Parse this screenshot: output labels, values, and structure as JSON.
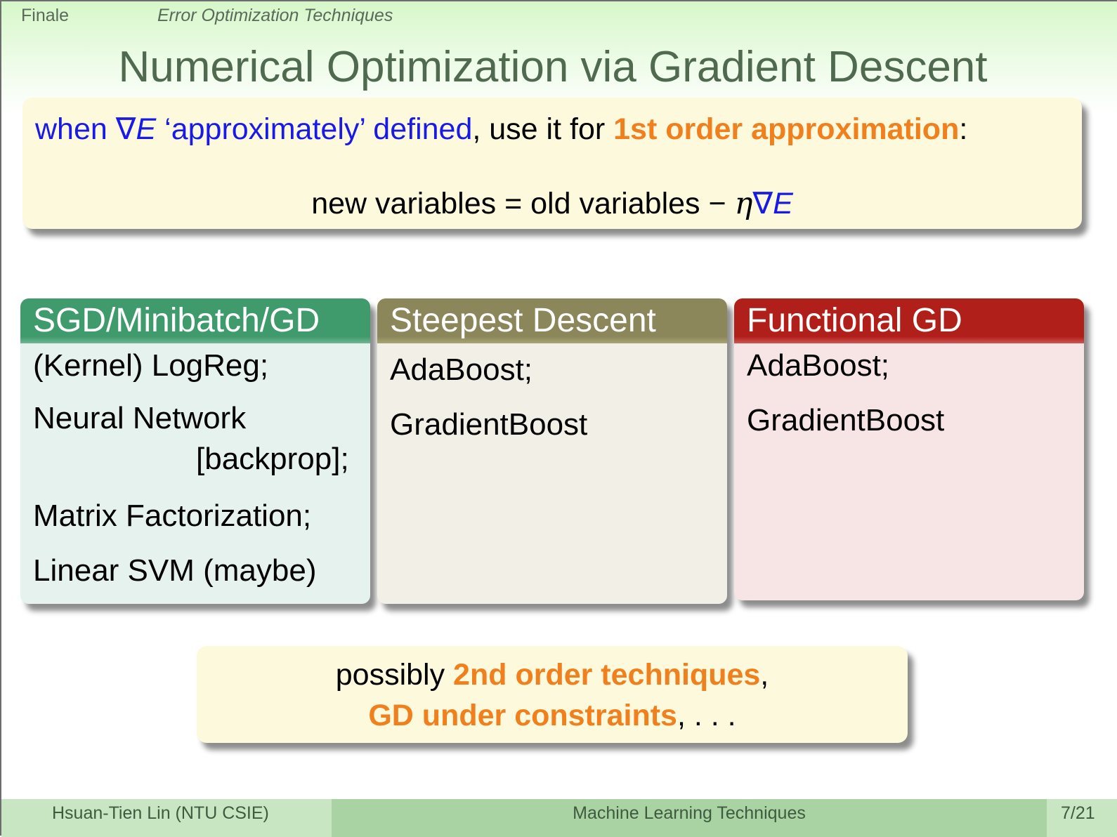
{
  "header": {
    "section": "Finale",
    "subsection": "Error Optimization Techniques"
  },
  "title": "Numerical Optimization via Gradient Descent",
  "top_box": {
    "when": "when",
    "nabla": "∇",
    "E": "E",
    "approx_defined": "‘approximately’ defined",
    "use_it_for": ", use it for ",
    "first_order": "1st order approximation",
    "colon": ":",
    "formula_left": "new variables = old variables − ",
    "formula_eta": "η",
    "formula_nabla": "∇",
    "formula_E": "E"
  },
  "cards": [
    {
      "heading": "SGD/Minibatch/GD",
      "items": [
        "(Kernel) LogReg;",
        "Neural Network",
        "[backprop];",
        "Matrix Factorization;",
        "Linear SVM (maybe)"
      ]
    },
    {
      "heading": "Steepest Descent",
      "items": [
        "AdaBoost;",
        "GradientBoost"
      ]
    },
    {
      "heading": "Functional GD",
      "items": [
        "AdaBoost;",
        "GradientBoost"
      ]
    }
  ],
  "bottom_box": {
    "possibly": "possibly ",
    "second_order": "2nd order techniques",
    "comma1": ",",
    "gd_constraints": "GD under constraints",
    "ellipsis": ", . . ."
  },
  "footer": {
    "author": "Hsuan-Tien Lin  (NTU CSIE)",
    "course": "Machine Learning Techniques",
    "page": "7/21"
  },
  "colors": {
    "accent_blue": "#1a1ae6",
    "accent_orange": "#f0801e",
    "card1_head": "#3f9a6c",
    "card2_head": "#8b875a",
    "card3_head": "#b11f1a"
  }
}
